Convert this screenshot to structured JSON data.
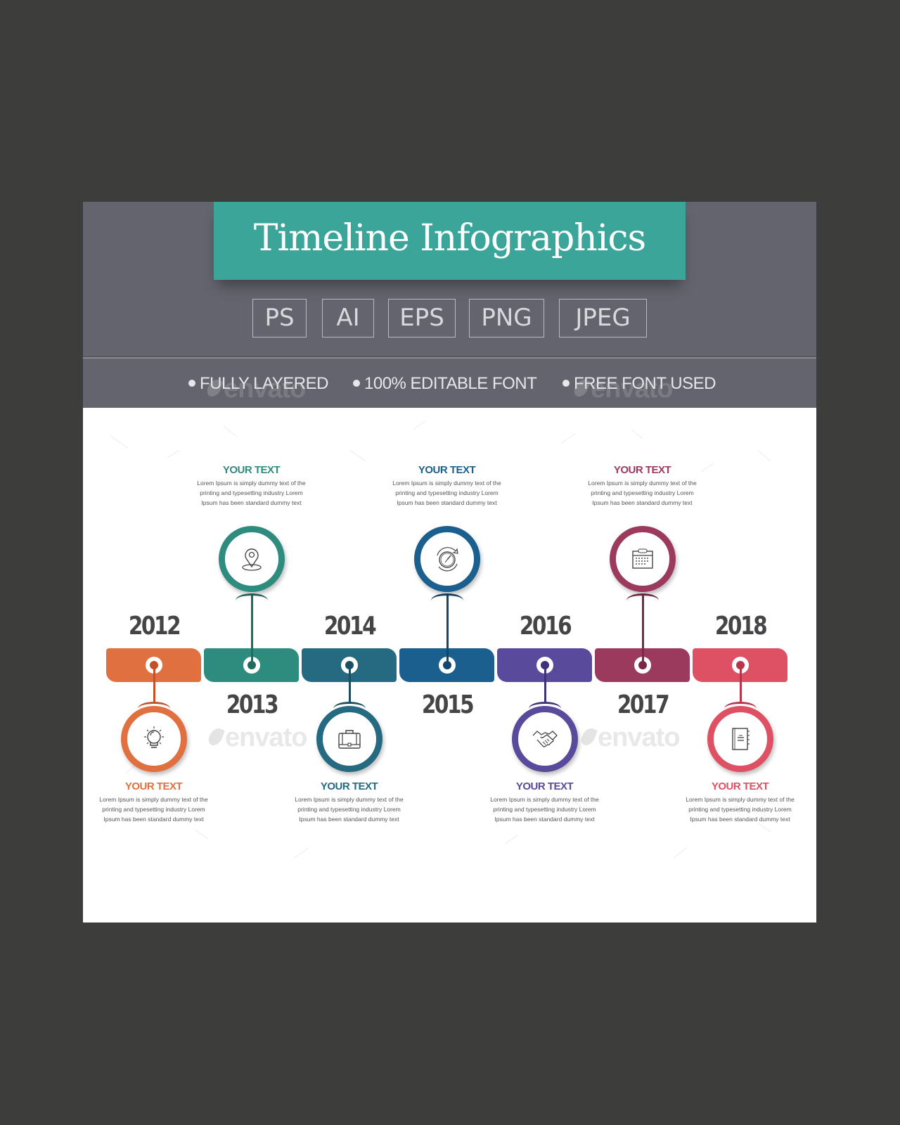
{
  "header": {
    "title": "Timeline Infographics",
    "formats": [
      "PS",
      "AI",
      "EPS",
      "PNG",
      "JPEG"
    ],
    "features": [
      "FULLY LAYERED",
      "100% EDITABLE FONT",
      "FREE FONT USED"
    ]
  },
  "watermark": "envato",
  "colors": {
    "page_background": "#3d3e3c",
    "header_background": "#63646d",
    "title_banner": "#3ba59a",
    "year_text": "#454547"
  },
  "timeline": [
    {
      "year": "2012",
      "position": "below",
      "color": "#e0703f",
      "dark": "#c4512a",
      "icon": "lightbulb-icon",
      "title": "YOUR TEXT",
      "desc": "Lorem Ipsum is simply dummy text of the printing and typesetting industry Lorem Ipsum has been standard dummy text"
    },
    {
      "year": "2013",
      "position": "above",
      "color": "#2e8c7e",
      "dark": "#1f6b60",
      "icon": "map-pin-icon",
      "title": "YOUR TEXT",
      "desc": "Lorem Ipsum is simply dummy text of the printing and typesetting industry Lorem Ipsum has been standard dummy text"
    },
    {
      "year": "2014",
      "position": "below",
      "color": "#256a80",
      "dark": "#1a4f60",
      "icon": "briefcase-icon",
      "title": "YOUR TEXT",
      "desc": "Lorem Ipsum is simply dummy text of the printing and typesetting industry Lorem Ipsum has been standard dummy text"
    },
    {
      "year": "2015",
      "position": "above",
      "color": "#1b5f8f",
      "dark": "#13466b",
      "icon": "stopwatch-icon",
      "title": "YOUR TEXT",
      "desc": "Lorem Ipsum is simply dummy text of the printing and typesetting industry Lorem Ipsum has been standard dummy text"
    },
    {
      "year": "2016",
      "position": "below",
      "color": "#5a4a9c",
      "dark": "#3f327a",
      "icon": "handshake-icon",
      "title": "YOUR TEXT",
      "desc": "Lorem Ipsum is simply dummy text of the printing and typesetting industry Lorem Ipsum has been standard dummy text"
    },
    {
      "year": "2017",
      "position": "above",
      "color": "#9c3a5e",
      "dark": "#7a2846",
      "icon": "calendar-icon",
      "title": "YOUR TEXT",
      "desc": "Lorem Ipsum is simply dummy text of the printing and typesetting industry Lorem Ipsum has been standard dummy text"
    },
    {
      "year": "2018",
      "position": "below",
      "color": "#de5063",
      "dark": "#b83449",
      "icon": "notebook-icon",
      "title": "YOUR TEXT",
      "desc": "Lorem Ipsum is simply dummy text of the printing and typesetting industry Lorem Ipsum has been standard dummy text"
    }
  ]
}
